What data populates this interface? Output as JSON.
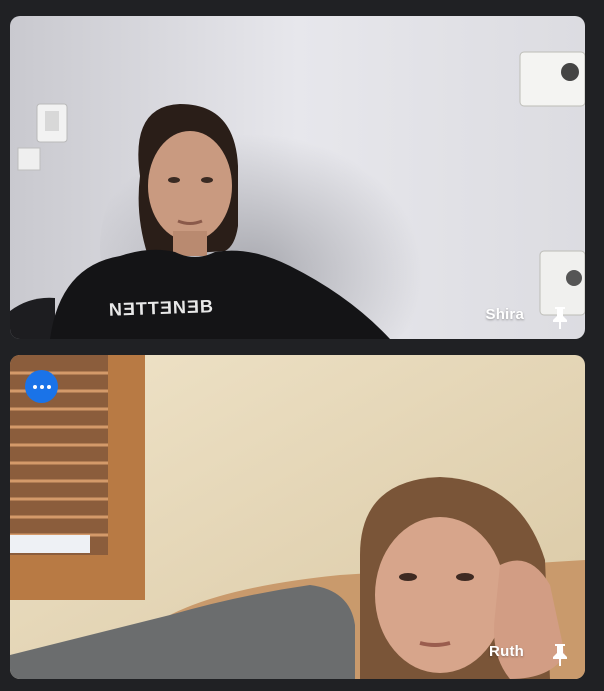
{
  "participants": [
    {
      "name": "Shira",
      "pinned_icon": "pin-icon"
    },
    {
      "name": "Ruth",
      "pinned_icon": "pin-icon",
      "options_icon": "more-options-icon"
    }
  ],
  "colors": {
    "background": "#202124",
    "accent": "#1a73e8",
    "label": "#ffffff"
  }
}
